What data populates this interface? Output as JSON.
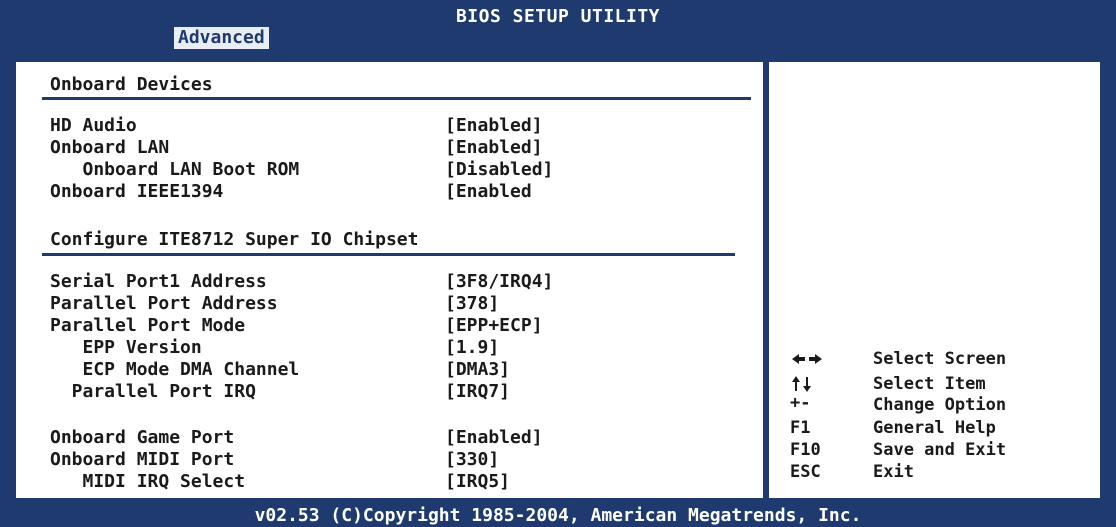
{
  "header": {
    "title": "BIOS SETUP UTILITY",
    "active_tab": "Advanced"
  },
  "main": {
    "section1_title": "Onboard Devices",
    "section1_items": [
      {
        "label": "HD Audio",
        "value": "[Enabled]"
      },
      {
        "label": "Onboard LAN",
        "value": "[Enabled]"
      },
      {
        "label": "   Onboard LAN Boot ROM",
        "value": "[Disabled]"
      },
      {
        "label": "Onboard IEEE1394",
        "value": "[Enabled"
      }
    ],
    "section2_title": "Configure ITE8712 Super IO Chipset",
    "section2_items": [
      {
        "label": "Serial Port1 Address",
        "value": "[3F8/IRQ4]"
      },
      {
        "label": "Parallel Port Address",
        "value": "[378]"
      },
      {
        "label": "Parallel Port Mode",
        "value": "[EPP+ECP]"
      },
      {
        "label": "   EPP Version",
        "value": "[1.9]"
      },
      {
        "label": "   ECP Mode DMA Channel",
        "value": "[DMA3]"
      },
      {
        "label": "  Parallel Port IRQ",
        "value": "[IRQ7]"
      },
      {
        "label": "Onboard Game Port",
        "value": "[Enabled]"
      },
      {
        "label": "Onboard MIDI Port",
        "value": "[330]"
      },
      {
        "label": "   MIDI IRQ Select",
        "value": "[IRQ5]"
      }
    ]
  },
  "help": {
    "items": [
      {
        "key_icon": "left-right-arrows-icon",
        "key": "",
        "text": "Select Screen"
      },
      {
        "key_icon": "up-down-arrows-icon",
        "key": "",
        "text": "Select Item"
      },
      {
        "key_icon": "",
        "key": "+-",
        "text": "Change Option"
      },
      {
        "key_icon": "",
        "key": "F1",
        "text": "General Help"
      },
      {
        "key_icon": "",
        "key": "F10",
        "text": "Save and Exit"
      },
      {
        "key_icon": "",
        "key": "ESC",
        "text": "Exit"
      }
    ]
  },
  "footer": {
    "copyright": "v02.53 (C)Copyright 1985-2004, American Megatrends, Inc."
  },
  "colors": {
    "frame": "#1e3a6e",
    "background": "#ffffff",
    "text": "#1a1a1a"
  }
}
